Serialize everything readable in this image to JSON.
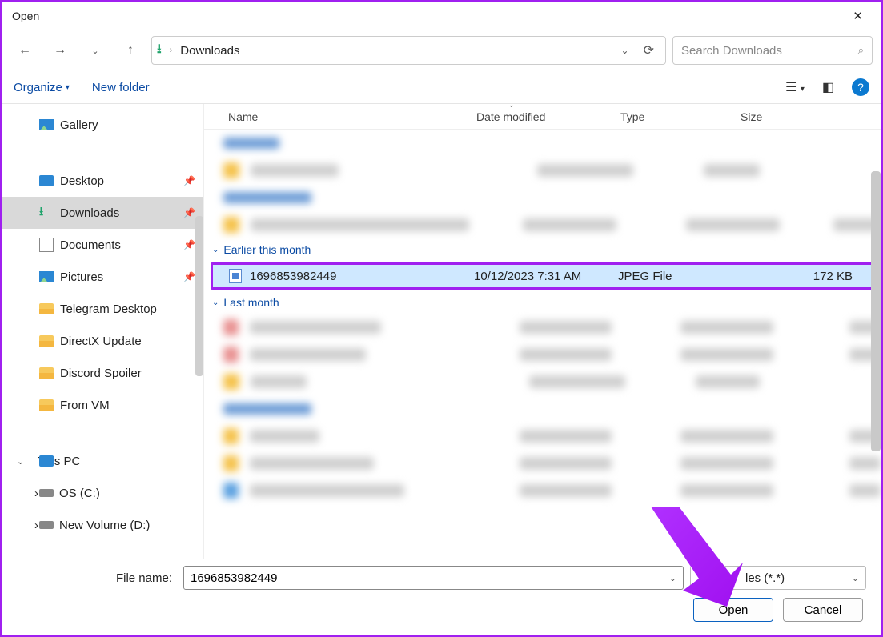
{
  "window": {
    "title": "Open"
  },
  "nav": {
    "location": "Downloads",
    "search_placeholder": "Search Downloads"
  },
  "toolbar": {
    "organize": "Organize",
    "new_folder": "New folder"
  },
  "sidebar": {
    "gallery": "Gallery",
    "quick": [
      {
        "label": "Desktop",
        "pinned": true,
        "icon": "monitor"
      },
      {
        "label": "Downloads",
        "pinned": true,
        "icon": "download",
        "selected": true
      },
      {
        "label": "Documents",
        "pinned": true,
        "icon": "document"
      },
      {
        "label": "Pictures",
        "pinned": true,
        "icon": "picture"
      },
      {
        "label": "Telegram Desktop",
        "pinned": false,
        "icon": "folder"
      },
      {
        "label": "DirectX Update",
        "pinned": false,
        "icon": "folder"
      },
      {
        "label": "Discord Spoiler",
        "pinned": false,
        "icon": "folder"
      },
      {
        "label": "From VM",
        "pinned": false,
        "icon": "folder"
      }
    ],
    "this_pc": {
      "label": "This PC",
      "drives": [
        "OS (C:)",
        "New Volume (D:)"
      ]
    }
  },
  "columns": {
    "name": "Name",
    "date": "Date modified",
    "type": "Type",
    "size": "Size"
  },
  "groups": {
    "earlier_month": "Earlier this month",
    "last_month": "Last month"
  },
  "selected_file": {
    "name": "1696853982449",
    "date": "10/12/2023 7:31 AM",
    "type": "JPEG File",
    "size": "172 KB"
  },
  "footer": {
    "file_name_label": "File name:",
    "file_name_value": "1696853982449",
    "filter_partial": "les (*.*)",
    "open": "Open",
    "cancel": "Cancel"
  }
}
